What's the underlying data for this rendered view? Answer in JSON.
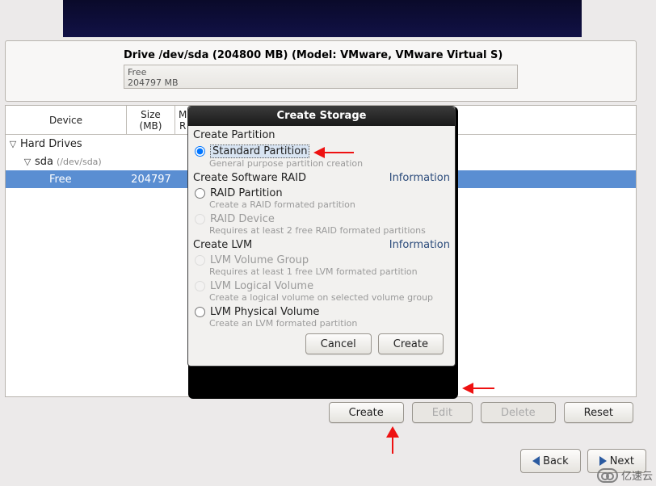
{
  "drive": {
    "title": "Drive /dev/sda (204800 MB) (Model: VMware, VMware Virtual S)",
    "bar_label": "Free",
    "bar_size": "204797 MB"
  },
  "table": {
    "headers": {
      "device": "Device",
      "size": "Size\n(MB)",
      "mp": "M\nR"
    },
    "rows": {
      "hard_drives": "Hard Drives",
      "sda": "sda",
      "sda_dev": "(/dev/sda)",
      "free": "Free",
      "free_size": "204797"
    }
  },
  "dialog": {
    "title": "Create Storage",
    "create_partition": "Create Partition",
    "standard_partition": "Standard Partition",
    "standard_partition_desc": "General purpose partition creation",
    "create_raid": "Create Software RAID",
    "raid_partition": "RAID Partition",
    "raid_partition_desc": "Create a RAID formated partition",
    "raid_device": "RAID Device",
    "raid_device_desc": "Requires at least 2 free RAID formated partitions",
    "create_lvm": "Create LVM",
    "lvm_vg": "LVM Volume Group",
    "lvm_vg_desc": "Requires at least 1 free LVM formated partition",
    "lvm_lv": "LVM Logical Volume",
    "lvm_lv_desc": "Create a logical volume on selected volume group",
    "lvm_pv": "LVM Physical Volume",
    "lvm_pv_desc": "Create an LVM formated partition",
    "information": "Information",
    "cancel": "Cancel",
    "create": "Create"
  },
  "main_buttons": {
    "create": "Create",
    "edit": "Edit",
    "delete": "Delete",
    "reset": "Reset"
  },
  "nav": {
    "back": "Back",
    "next": "Next"
  },
  "watermark": "亿速云"
}
